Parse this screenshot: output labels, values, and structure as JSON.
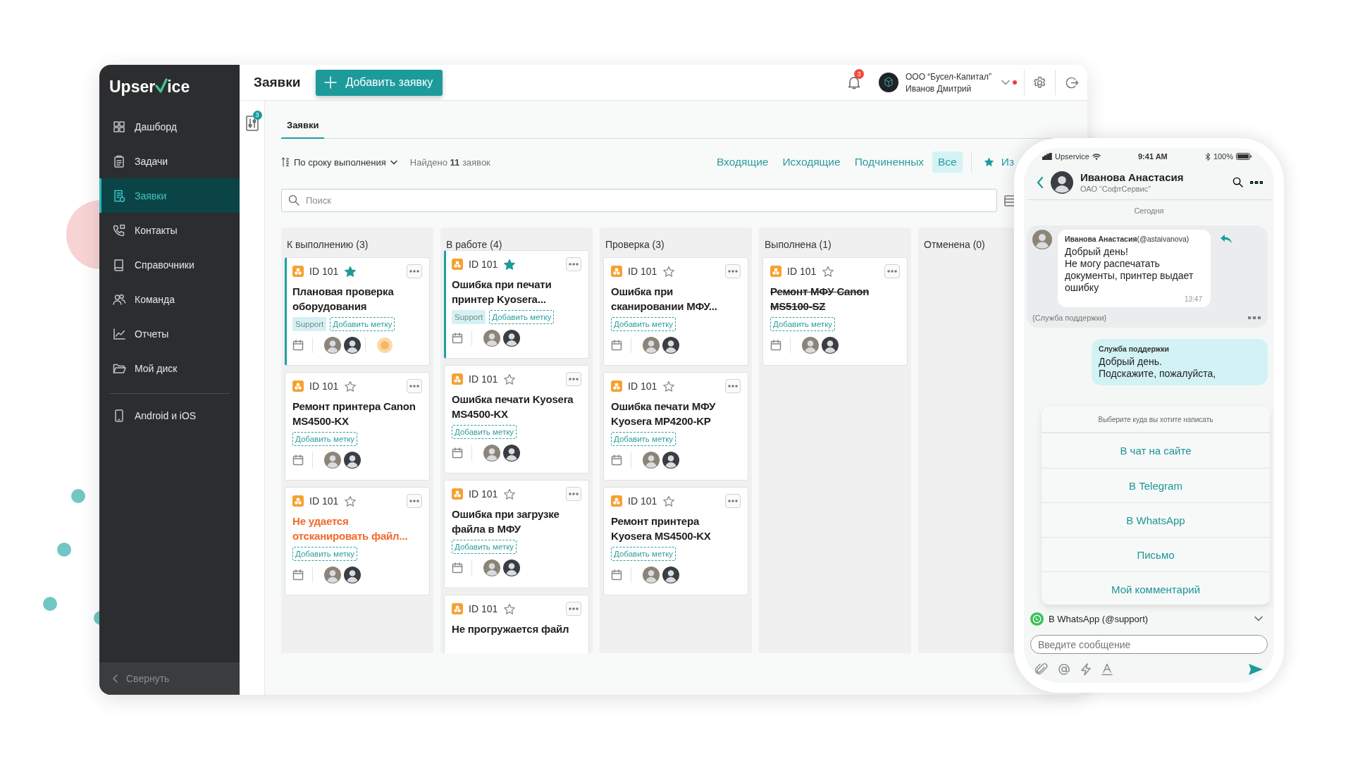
{
  "sidebar": {
    "logo": {
      "start": "Upser",
      "end": "ice"
    },
    "items": [
      {
        "label": "Дашборд",
        "selected": false
      },
      {
        "label": "Задачи",
        "selected": false
      },
      {
        "label": "Заявки",
        "selected": true
      },
      {
        "label": "Контакты",
        "selected": false
      },
      {
        "label": "Справочники",
        "selected": false
      },
      {
        "label": "Команда",
        "selected": false
      },
      {
        "label": "Отчеты",
        "selected": false
      },
      {
        "label": "Мой диск",
        "selected": false
      }
    ],
    "bottom_items": [
      {
        "label": "Android и iOS",
        "selected": false
      }
    ],
    "collapse": "Свернуть"
  },
  "header": {
    "title": "Заявки",
    "add_button": "Добавить заявку",
    "notifications": "3",
    "company": "ООО “Бусел-Капитал”",
    "user": "Иванов Дмитрий"
  },
  "filters_panel": {
    "badge": "3"
  },
  "view_tabs": [
    {
      "label": "Заявки",
      "selected": true
    }
  ],
  "toolbar": {
    "sort": "По сроку выполнения",
    "found": "Найдено **11** заявок",
    "filters": [
      {
        "label": "Входящие",
        "selected": false
      },
      {
        "label": "Исходящие",
        "selected": false
      },
      {
        "label": "Подчиненных",
        "selected": false
      },
      {
        "label": "Все",
        "selected": true
      }
    ],
    "favorites": "Из"
  },
  "search": {
    "placeholder": "Поиск"
  },
  "columns": [
    {
      "title": "К выполнению (3)",
      "cards": [
        {
          "id": "ID 101",
          "starred": true,
          "highlighted": true,
          "overdue": false,
          "done": false,
          "title": "Плановая проверка оборудования",
          "tags": [
            {
              "kind": "tag",
              "label": "Support"
            },
            {
              "kind": "add",
              "label": "Добавить метку"
            }
          ],
          "assignees": [
            {
              "kind": "photo"
            },
            {
              "kind": "photo"
            },
            {
              "kind": "emoji"
            }
          ]
        },
        {
          "id": "ID 101",
          "starred": false,
          "highlighted": false,
          "overdue": false,
          "done": false,
          "title": "Ремонт принтера Canon MS4500-KX",
          "tags": [
            {
              "kind": "add",
              "label": "Добавить метку"
            }
          ],
          "assignees": [
            {
              "kind": "photo"
            },
            {
              "kind": "photo"
            }
          ]
        },
        {
          "id": "ID 101",
          "starred": false,
          "highlighted": false,
          "overdue": true,
          "done": false,
          "title": "Не удается отсканировать файл...",
          "tags": [
            {
              "kind": "add",
              "label": "Добавить метку"
            }
          ],
          "assignees": [
            {
              "kind": "photo"
            },
            {
              "kind": "photo"
            }
          ]
        }
      ]
    },
    {
      "title": "В работе (4)",
      "cards": [
        {
          "id": "ID 101",
          "starred": true,
          "highlighted": true,
          "overdue": false,
          "done": false,
          "title": "Ошибка при печати принтер Kyosera...",
          "tags": [
            {
              "kind": "tag",
              "label": "Support"
            },
            {
              "kind": "add",
              "label": "Добавить метку"
            }
          ],
          "assignees": [
            {
              "kind": "photo"
            },
            {
              "kind": "photo"
            }
          ]
        },
        {
          "id": "ID 101",
          "starred": false,
          "highlighted": false,
          "overdue": false,
          "done": false,
          "title": "Ошибка печати Kyosera MS4500-KX",
          "tags": [
            {
              "kind": "add",
              "label": "Добавить метку"
            }
          ],
          "assignees": [
            {
              "kind": "photo"
            },
            {
              "kind": "photo"
            }
          ]
        },
        {
          "id": "ID 101",
          "starred": false,
          "highlighted": false,
          "overdue": false,
          "done": false,
          "title": "Ошибка при загрузке файла в МФУ",
          "tags": [
            {
              "kind": "add",
              "label": "Добавить метку"
            }
          ],
          "assignees": [
            {
              "kind": "photo"
            },
            {
              "kind": "photo"
            }
          ]
        },
        {
          "id": "ID 101",
          "starred": false,
          "highlighted": false,
          "overdue": false,
          "done": false,
          "title": "Не прогружается файл"
        }
      ]
    },
    {
      "title": "Проверка (3)",
      "cards": [
        {
          "id": "ID 101",
          "starred": false,
          "highlighted": false,
          "overdue": false,
          "done": false,
          "title": "Ошибка при сканировании МФУ...",
          "tags": [
            {
              "kind": "add",
              "label": "Добавить метку"
            }
          ],
          "assignees": [
            {
              "kind": "photo"
            },
            {
              "kind": "photo"
            }
          ]
        },
        {
          "id": "ID 101",
          "starred": false,
          "highlighted": false,
          "overdue": false,
          "done": false,
          "title": "Ошибка печати МФУ Kyosera MP4200-KP",
          "tags": [
            {
              "kind": "add",
              "label": "Добавить метку"
            }
          ],
          "assignees": [
            {
              "kind": "photo"
            },
            {
              "kind": "photo"
            }
          ]
        },
        {
          "id": "ID 101",
          "starred": false,
          "highlighted": false,
          "overdue": false,
          "done": false,
          "title": "Ремонт принтера Kyosera MS4500-KX",
          "tags": [
            {
              "kind": "add",
              "label": "Добавить метку"
            }
          ],
          "assignees": [
            {
              "kind": "photo"
            },
            {
              "kind": "photo"
            }
          ]
        }
      ]
    },
    {
      "title": "Выполнена (1)",
      "cards": [
        {
          "id": "ID 101",
          "starred": false,
          "highlighted": false,
          "overdue": false,
          "done": true,
          "title": "Ремонт МФУ Canon MS5100-SZ",
          "tags": [
            {
              "kind": "add",
              "label": "Добавить метку"
            }
          ],
          "assignees": [
            {
              "kind": "photo"
            },
            {
              "kind": "photo"
            }
          ]
        }
      ]
    },
    {
      "title": "Отменена (0)"
    }
  ],
  "phone": {
    "status": {
      "carrier": "Upservice",
      "time": "9:41 AM",
      "battery": "100%"
    },
    "contact": {
      "name": "Иванова Анастасия",
      "company": "ОАО “СофтСервис”"
    },
    "date": "Сегодня",
    "messages": [
      {
        "kind": "incoming",
        "author": "**Иванова Анастасия**(@astaivanova)",
        "text": "Добрый день!\nНе могу распечатать документы, принтер выдает ошибку",
        "time": "13:47",
        "footer": "{Служба поддержки}"
      },
      {
        "kind": "outgoing",
        "author": "Служба поддержки",
        "text": "Добрый день.\nПодскажите, пожалуйста,"
      }
    ],
    "menu": {
      "title": "Выберите куда вы хотите написать",
      "options": [
        "В чат на сайте",
        "В Telegram",
        "В WhatsApp",
        "Письмо",
        "Мой комментарий"
      ]
    },
    "channel": "В WhatsApp (@support)",
    "input": {
      "placeholder": "Введите сообщение"
    }
  }
}
